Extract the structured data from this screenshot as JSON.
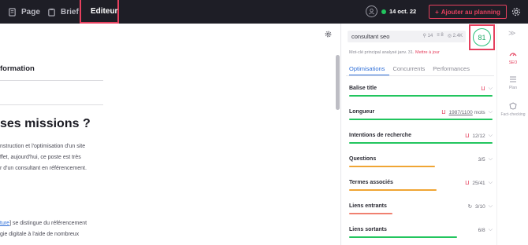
{
  "topbar": {
    "tabs": [
      {
        "label": "Page",
        "icon": "document-icon"
      },
      {
        "label": "Brief",
        "icon": "clipboard-icon"
      },
      {
        "label": "Editeur",
        "icon": "pencil-icon"
      }
    ],
    "date": "14 oct. 22",
    "plan_button": "Ajouter au planning",
    "accent": "#e5405e"
  },
  "editor": {
    "heading_info": "formation",
    "heading_missions": "ses missions ?",
    "para1": [
      "nstruction et l'optimisation d'un site",
      "ffet, aujourd'hui, ce poste est très",
      "r d'un consultant en référencement."
    ],
    "para2_link": "ture",
    "para2_after": "] se distingue du référencement",
    "para2_line2": "gie digitale à l'aide de nombreux"
  },
  "panel": {
    "keyword": "consultant seo",
    "kw_stats": [
      "14",
      "8",
      "2.4K"
    ],
    "score": "81",
    "kw_note": "Mot-clé principal analysé janv. 31.",
    "kw_update": "Mettre à jour",
    "tabs": [
      "Optimisations",
      "Concurrents",
      "Performances"
    ],
    "criteria": [
      {
        "label": "Balise title",
        "value": "",
        "progress": 1.0,
        "color": "#22c55e"
      },
      {
        "label": "Longueur",
        "value": "1987/1100",
        "unit": "mots",
        "progress": 1.0,
        "color": "#22c55e"
      },
      {
        "label": "Intentions de recherche",
        "value": "12/12",
        "progress": 1.0,
        "color": "#22c55e"
      },
      {
        "label": "Questions",
        "value": "3/5",
        "progress": 0.6,
        "color": "#f0a534"
      },
      {
        "label": "Termes associés",
        "value": "25/41",
        "progress": 0.61,
        "color": "#f0a534"
      },
      {
        "label": "Liens entrants",
        "value": "3/10",
        "progress": 0.3,
        "color": "#f08070"
      },
      {
        "label": "Liens sortants",
        "value": "6/8",
        "progress": 0.75,
        "color": "#22c55e"
      }
    ]
  },
  "rightbar": {
    "items": [
      "SEO",
      "Plan",
      "Fact-checking"
    ]
  }
}
